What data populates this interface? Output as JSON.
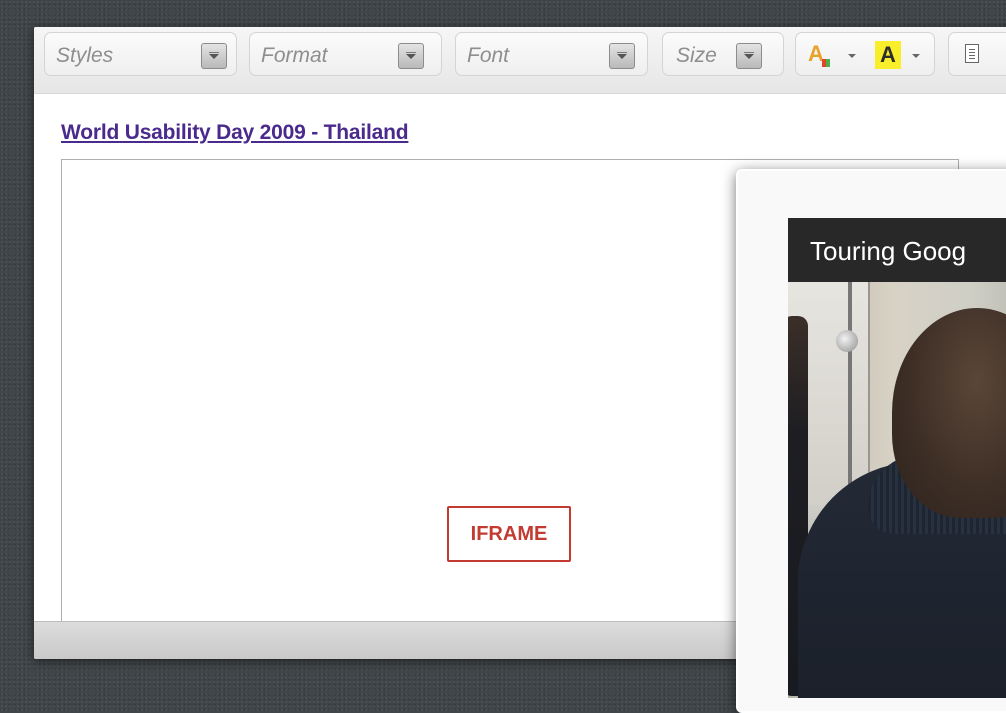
{
  "toolbar": {
    "styles_label": "Styles",
    "format_label": "Format",
    "font_label": "Font",
    "size_label": "Size",
    "text_color_glyph": "A",
    "bg_color_glyph": "A"
  },
  "content": {
    "link_title": "World Usability Day 2009 - Thailand",
    "iframe_placeholder": "IFRAME"
  },
  "popup": {
    "video_title": "Touring Goog"
  },
  "icons": {
    "dropdown": "chevron-down-icon",
    "text_color": "text-color-icon",
    "bg_color": "background-color-icon",
    "source": "document-icon"
  },
  "colors": {
    "link": "#4a2a8c",
    "iframe_tag": "#c23a30",
    "highlight": "#f8ef2a"
  }
}
